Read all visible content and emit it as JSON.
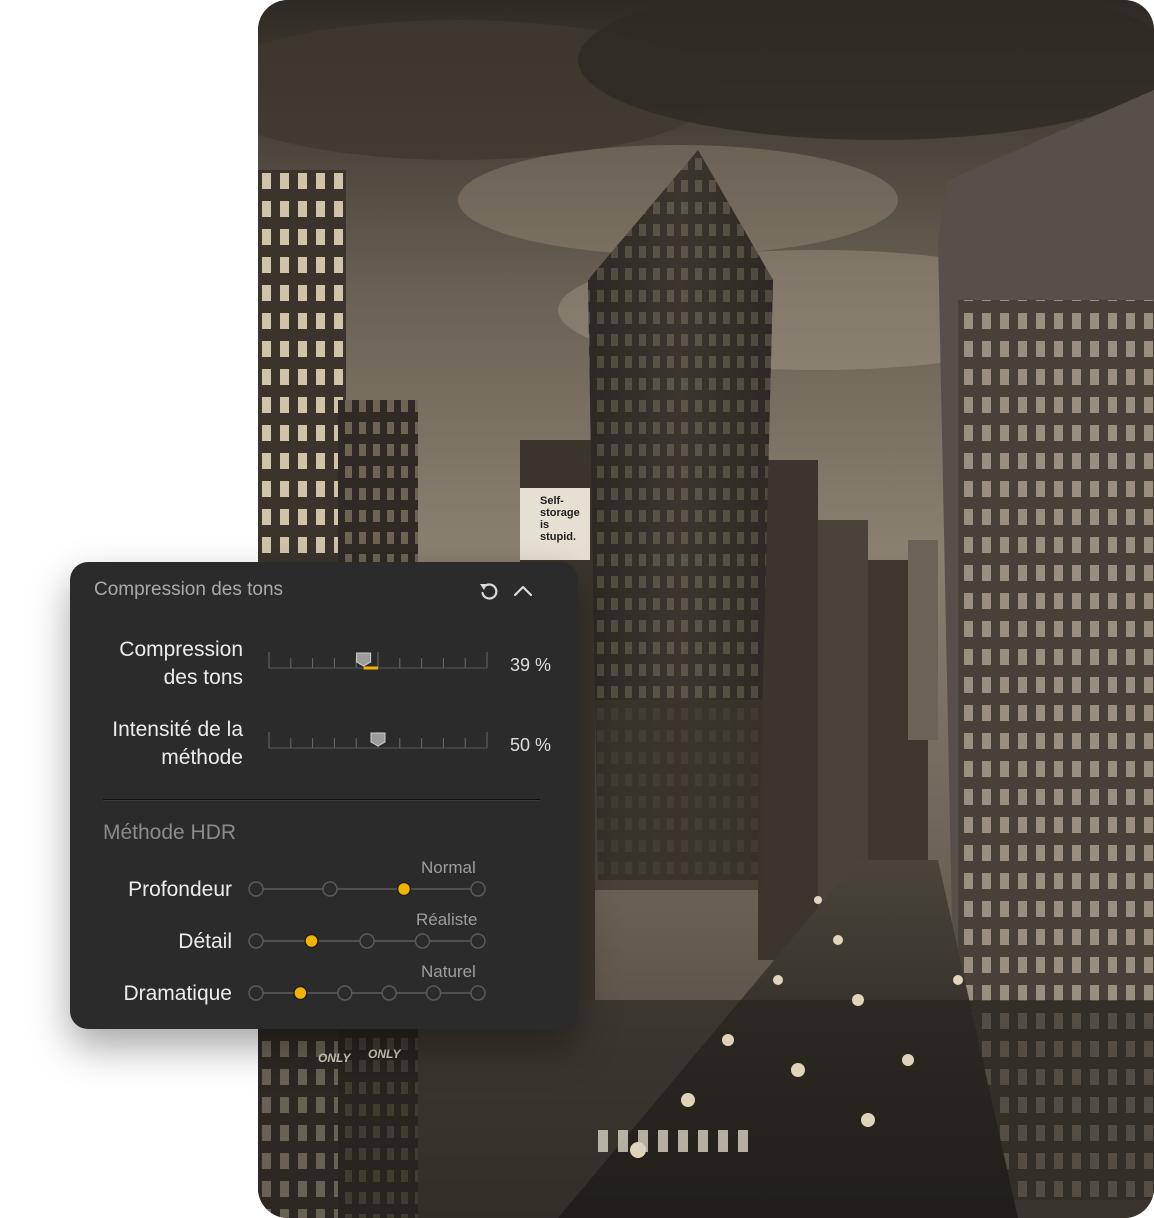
{
  "photo": {
    "billboard_text": [
      "Self-",
      "storage",
      "is",
      "stupid."
    ],
    "road_markings": [
      "ONLY",
      "ONLY"
    ]
  },
  "panel": {
    "title": "Compression des tons",
    "reset_icon": "reset-icon",
    "collapse_icon": "chevron-up-icon",
    "sliders": [
      {
        "label_line1": "Compression",
        "label_line2": "des tons",
        "value": 39,
        "value_text": "39 %"
      },
      {
        "label_line1": "Intensité de la",
        "label_line2": "méthode",
        "value": 50,
        "value_text": "50 %"
      }
    ],
    "section_title": "Méthode HDR",
    "steppers": [
      {
        "label": "Profondeur",
        "caption": "Normal",
        "steps": 4,
        "selected_index": 2
      },
      {
        "label": "Détail",
        "caption": "Réaliste",
        "steps": 5,
        "selected_index": 1
      },
      {
        "label": "Dramatique",
        "caption": "Naturel",
        "steps": 6,
        "selected_index": 1
      }
    ],
    "accent_color": "#f0b400"
  }
}
